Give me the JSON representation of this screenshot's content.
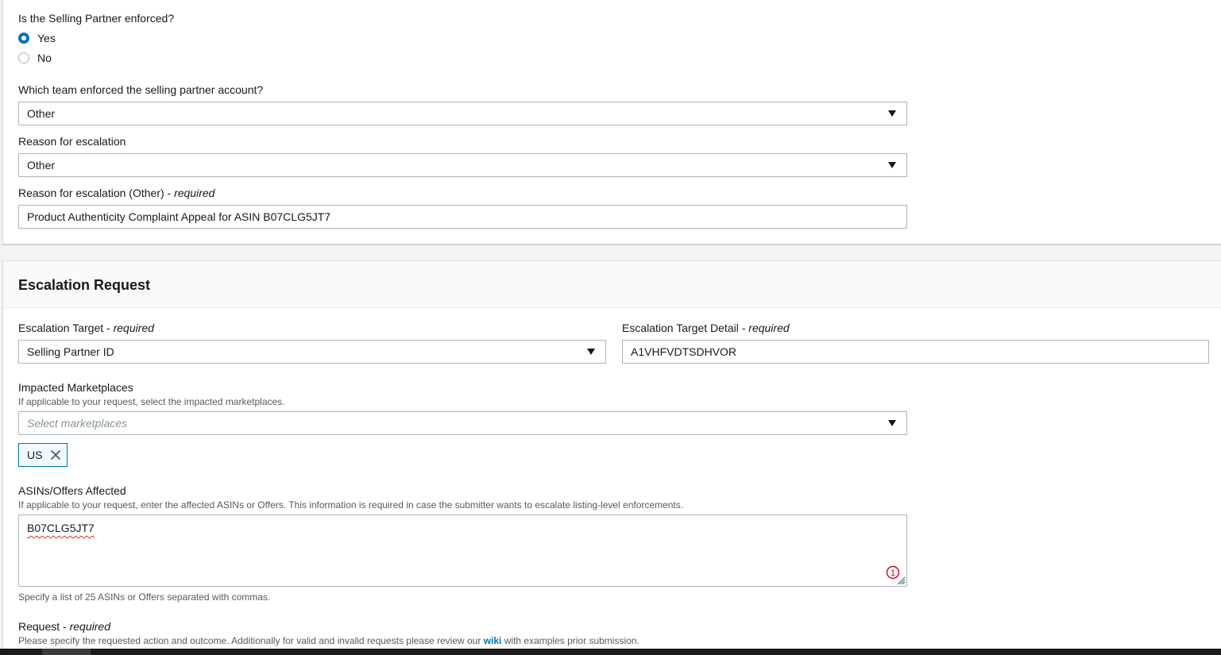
{
  "partner_section": {
    "enforced_question": "Is the Selling Partner enforced?",
    "radio_yes": "Yes",
    "radio_no": "No",
    "selected": "Yes",
    "team_question": "Which team enforced the selling partner account?",
    "team_value": "Other",
    "reason_label": "Reason for escalation",
    "reason_value": "Other",
    "reason_other_label": "Reason for escalation (Other)",
    "reason_other_required": "required",
    "reason_other_value": "Product Authenticity Complaint Appeal for ASIN B07CLG5JT7"
  },
  "escalation": {
    "title": "Escalation Request",
    "target_label": "Escalation Target",
    "target_required": "required",
    "target_value": "Selling Partner ID",
    "target_detail_label": "Escalation Target Detail",
    "target_detail_required": "required",
    "target_detail_value": "A1VHFVDTSDHVOR",
    "marketplaces_label": "Impacted Marketplaces",
    "marketplaces_desc": "If applicable to your request, select the impacted marketplaces.",
    "marketplaces_placeholder": "Select marketplaces",
    "marketplace_tokens": [
      "US"
    ],
    "asins_label": "ASINs/Offers Affected",
    "asins_desc": "If applicable to your request, enter the affected ASINs or Offers. This information is required in case the submitter wants to escalate listing-level enforcements.",
    "asins_value": "B07CLG5JT7",
    "asins_badge_count": "1",
    "asins_hint": "Specify a list of 25 ASINs or Offers separated with commas.",
    "request_label": "Request",
    "request_required": "required",
    "request_desc_before": "Please specify the requested action and outcome. Additionally for valid and invalid requests please review our",
    "request_desc_link": "wiki",
    "request_desc_after": "with examples prior submission."
  },
  "colors": {
    "accent": "#0073bb",
    "error": "#d13212",
    "border": "#aab7b8"
  }
}
